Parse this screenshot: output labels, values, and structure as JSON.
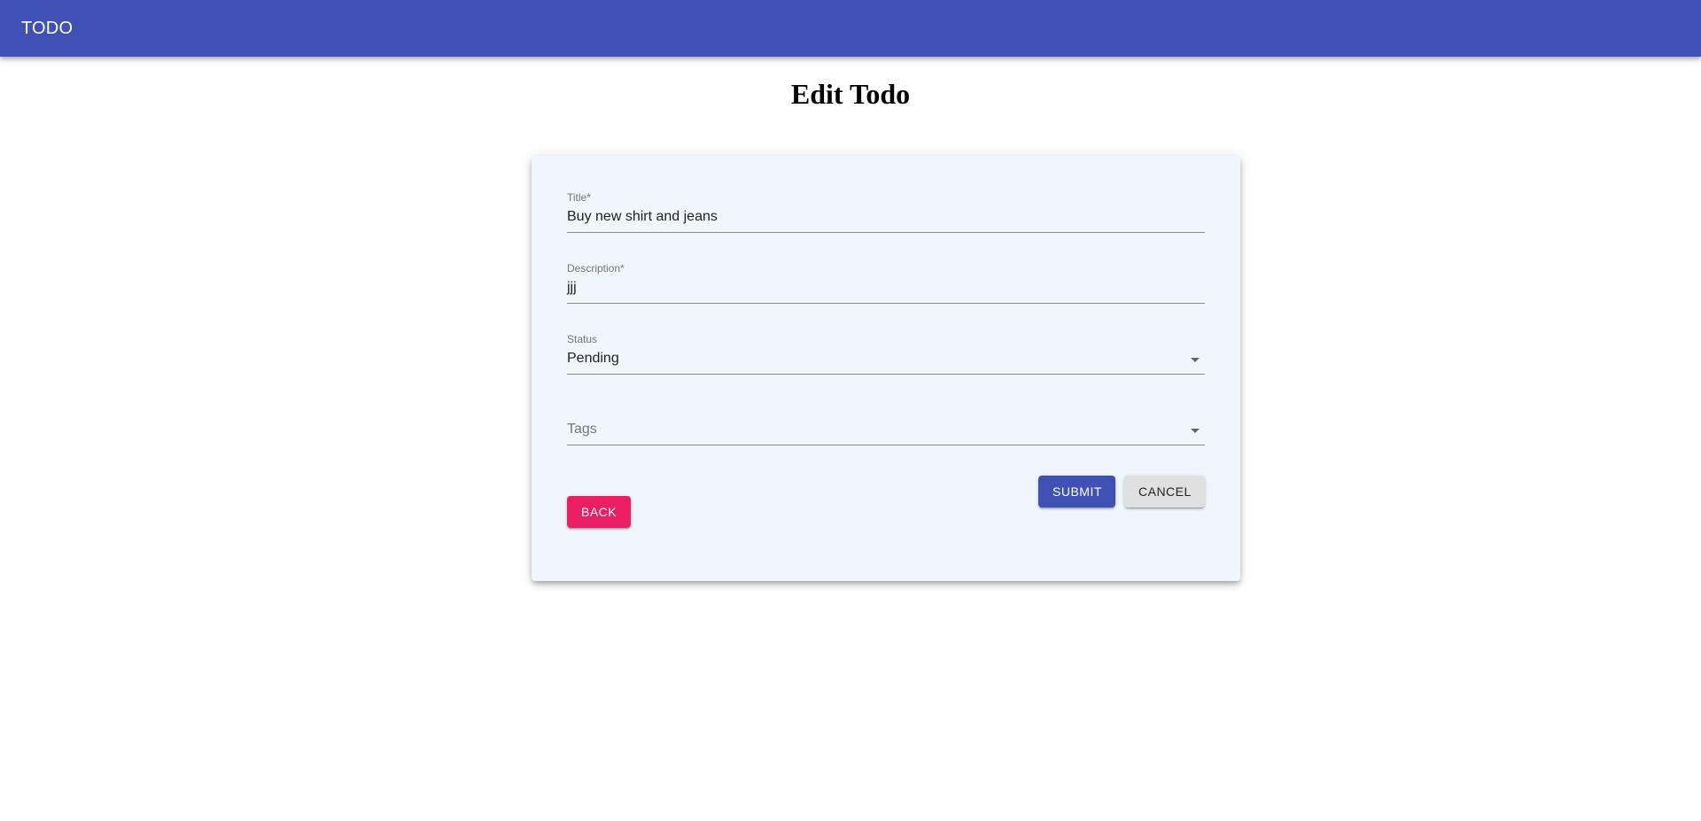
{
  "appbar": {
    "title": "TODO"
  },
  "page": {
    "heading": "Edit Todo"
  },
  "form": {
    "title": {
      "label": "Title*",
      "value": "Buy new shirt and jeans"
    },
    "description": {
      "label": "Description*",
      "value": "jjj"
    },
    "status": {
      "label": "Status",
      "value": "Pending",
      "icon": "chevron-down-icon"
    },
    "tags": {
      "placeholder": "Tags",
      "value": "",
      "icon": "chevron-down-icon"
    },
    "buttons": {
      "back": "BACK",
      "submit": "SUBMIT",
      "cancel": "CANCEL"
    }
  },
  "colors": {
    "appbar": "#3f51b5",
    "primary": "#3f51b5",
    "secondary": "#e91e63",
    "card_background": "#eff6fc",
    "cancel_background": "#e0e0e0"
  }
}
